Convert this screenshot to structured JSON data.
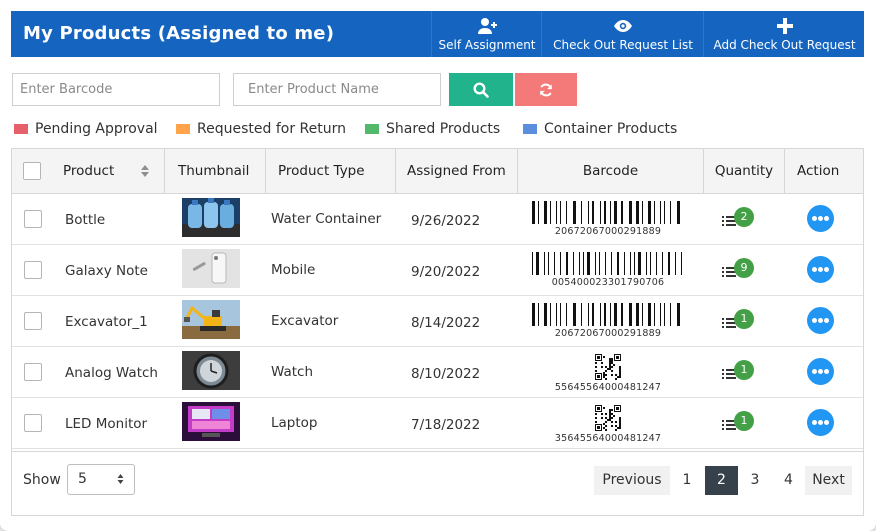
{
  "header": {
    "title": "My Products (Assigned to me)",
    "buttons": [
      {
        "label": "Self Assignment",
        "icon": "user-plus-icon"
      },
      {
        "label": "Check Out Request List",
        "icon": "eye-icon"
      },
      {
        "label": "Add Check Out Request",
        "icon": "plus-icon"
      }
    ]
  },
  "filters": {
    "barcode_placeholder": "Enter Barcode",
    "name_placeholder": "Enter Product Name",
    "search_icon": "search-icon",
    "reset_icon": "refresh-icon"
  },
  "legend": [
    {
      "label": "Pending Approval",
      "color": "#e5606b"
    },
    {
      "label": "Requested for Return",
      "color": "#ffa44a"
    },
    {
      "label": "Shared Products",
      "color": "#53b86a"
    },
    {
      "label": "Container Products",
      "color": "#5b8fdd"
    }
  ],
  "table": {
    "columns": [
      "Product",
      "Thumbnail",
      "Product Type",
      "Assigned From",
      "Barcode",
      "Quantity",
      "Action"
    ],
    "rows": [
      {
        "product": "Bottle",
        "type": "Water Container",
        "assigned_from": "9/26/2022",
        "barcode": "20672067000291889",
        "barcode_kind": "linear",
        "quantity": "2",
        "thumbnail": "water-bottles-image"
      },
      {
        "product": "Galaxy Note",
        "type": "Mobile",
        "assigned_from": "9/20/2022",
        "barcode": "005400023301790706",
        "barcode_kind": "linear",
        "quantity": "9",
        "thumbnail": "phone-image"
      },
      {
        "product": "Excavator_1",
        "type": "Excavator",
        "assigned_from": "8/14/2022",
        "barcode": "20672067000291889",
        "barcode_kind": "linear",
        "quantity": "1",
        "thumbnail": "excavator-image"
      },
      {
        "product": "Analog Watch",
        "type": "Watch",
        "assigned_from": "8/10/2022",
        "barcode": "556455640004812​47",
        "barcode_kind": "qr",
        "quantity": "1",
        "thumbnail": "watch-image"
      },
      {
        "product": "LED Monitor",
        "type": "Laptop",
        "assigned_from": "7/18/2022",
        "barcode": "356455640004812​47",
        "barcode_kind": "qr",
        "quantity": "1",
        "thumbnail": "monitor-image"
      }
    ]
  },
  "footer": {
    "show_label": "Show",
    "page_size": "5",
    "pagination": {
      "previous": "Previous",
      "pages": [
        "1",
        "2",
        "3",
        "4"
      ],
      "active": "2",
      "next": "Next"
    }
  }
}
